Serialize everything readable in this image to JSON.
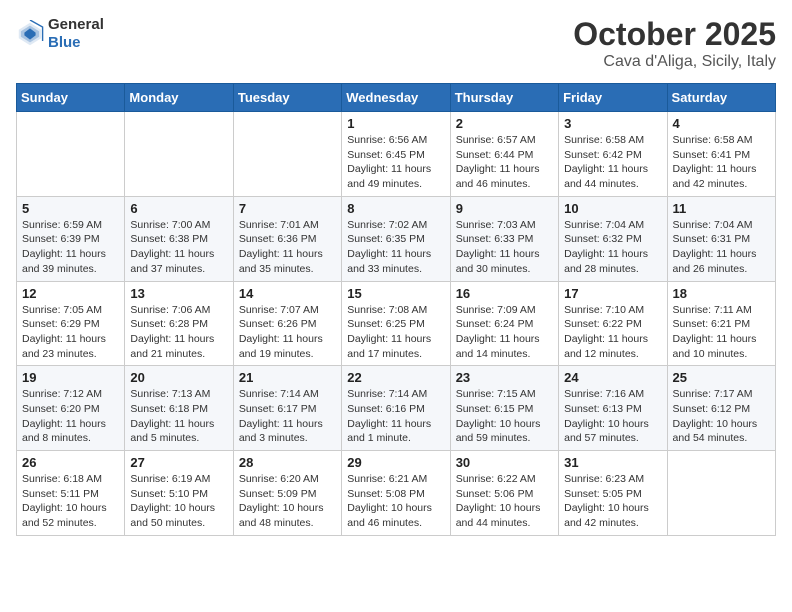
{
  "logo": {
    "text_general": "General",
    "text_blue": "Blue"
  },
  "title": "October 2025",
  "subtitle": "Cava d'Aliga, Sicily, Italy",
  "weekdays": [
    "Sunday",
    "Monday",
    "Tuesday",
    "Wednesday",
    "Thursday",
    "Friday",
    "Saturday"
  ],
  "weeks": [
    [
      {
        "day": "",
        "info": ""
      },
      {
        "day": "",
        "info": ""
      },
      {
        "day": "",
        "info": ""
      },
      {
        "day": "1",
        "info": "Sunrise: 6:56 AM\nSunset: 6:45 PM\nDaylight: 11 hours and 49 minutes."
      },
      {
        "day": "2",
        "info": "Sunrise: 6:57 AM\nSunset: 6:44 PM\nDaylight: 11 hours and 46 minutes."
      },
      {
        "day": "3",
        "info": "Sunrise: 6:58 AM\nSunset: 6:42 PM\nDaylight: 11 hours and 44 minutes."
      },
      {
        "day": "4",
        "info": "Sunrise: 6:58 AM\nSunset: 6:41 PM\nDaylight: 11 hours and 42 minutes."
      }
    ],
    [
      {
        "day": "5",
        "info": "Sunrise: 6:59 AM\nSunset: 6:39 PM\nDaylight: 11 hours and 39 minutes."
      },
      {
        "day": "6",
        "info": "Sunrise: 7:00 AM\nSunset: 6:38 PM\nDaylight: 11 hours and 37 minutes."
      },
      {
        "day": "7",
        "info": "Sunrise: 7:01 AM\nSunset: 6:36 PM\nDaylight: 11 hours and 35 minutes."
      },
      {
        "day": "8",
        "info": "Sunrise: 7:02 AM\nSunset: 6:35 PM\nDaylight: 11 hours and 33 minutes."
      },
      {
        "day": "9",
        "info": "Sunrise: 7:03 AM\nSunset: 6:33 PM\nDaylight: 11 hours and 30 minutes."
      },
      {
        "day": "10",
        "info": "Sunrise: 7:04 AM\nSunset: 6:32 PM\nDaylight: 11 hours and 28 minutes."
      },
      {
        "day": "11",
        "info": "Sunrise: 7:04 AM\nSunset: 6:31 PM\nDaylight: 11 hours and 26 minutes."
      }
    ],
    [
      {
        "day": "12",
        "info": "Sunrise: 7:05 AM\nSunset: 6:29 PM\nDaylight: 11 hours and 23 minutes."
      },
      {
        "day": "13",
        "info": "Sunrise: 7:06 AM\nSunset: 6:28 PM\nDaylight: 11 hours and 21 minutes."
      },
      {
        "day": "14",
        "info": "Sunrise: 7:07 AM\nSunset: 6:26 PM\nDaylight: 11 hours and 19 minutes."
      },
      {
        "day": "15",
        "info": "Sunrise: 7:08 AM\nSunset: 6:25 PM\nDaylight: 11 hours and 17 minutes."
      },
      {
        "day": "16",
        "info": "Sunrise: 7:09 AM\nSunset: 6:24 PM\nDaylight: 11 hours and 14 minutes."
      },
      {
        "day": "17",
        "info": "Sunrise: 7:10 AM\nSunset: 6:22 PM\nDaylight: 11 hours and 12 minutes."
      },
      {
        "day": "18",
        "info": "Sunrise: 7:11 AM\nSunset: 6:21 PM\nDaylight: 11 hours and 10 minutes."
      }
    ],
    [
      {
        "day": "19",
        "info": "Sunrise: 7:12 AM\nSunset: 6:20 PM\nDaylight: 11 hours and 8 minutes."
      },
      {
        "day": "20",
        "info": "Sunrise: 7:13 AM\nSunset: 6:18 PM\nDaylight: 11 hours and 5 minutes."
      },
      {
        "day": "21",
        "info": "Sunrise: 7:14 AM\nSunset: 6:17 PM\nDaylight: 11 hours and 3 minutes."
      },
      {
        "day": "22",
        "info": "Sunrise: 7:14 AM\nSunset: 6:16 PM\nDaylight: 11 hours and 1 minute."
      },
      {
        "day": "23",
        "info": "Sunrise: 7:15 AM\nSunset: 6:15 PM\nDaylight: 10 hours and 59 minutes."
      },
      {
        "day": "24",
        "info": "Sunrise: 7:16 AM\nSunset: 6:13 PM\nDaylight: 10 hours and 57 minutes."
      },
      {
        "day": "25",
        "info": "Sunrise: 7:17 AM\nSunset: 6:12 PM\nDaylight: 10 hours and 54 minutes."
      }
    ],
    [
      {
        "day": "26",
        "info": "Sunrise: 6:18 AM\nSunset: 5:11 PM\nDaylight: 10 hours and 52 minutes."
      },
      {
        "day": "27",
        "info": "Sunrise: 6:19 AM\nSunset: 5:10 PM\nDaylight: 10 hours and 50 minutes."
      },
      {
        "day": "28",
        "info": "Sunrise: 6:20 AM\nSunset: 5:09 PM\nDaylight: 10 hours and 48 minutes."
      },
      {
        "day": "29",
        "info": "Sunrise: 6:21 AM\nSunset: 5:08 PM\nDaylight: 10 hours and 46 minutes."
      },
      {
        "day": "30",
        "info": "Sunrise: 6:22 AM\nSunset: 5:06 PM\nDaylight: 10 hours and 44 minutes."
      },
      {
        "day": "31",
        "info": "Sunrise: 6:23 AM\nSunset: 5:05 PM\nDaylight: 10 hours and 42 minutes."
      },
      {
        "day": "",
        "info": ""
      }
    ]
  ]
}
